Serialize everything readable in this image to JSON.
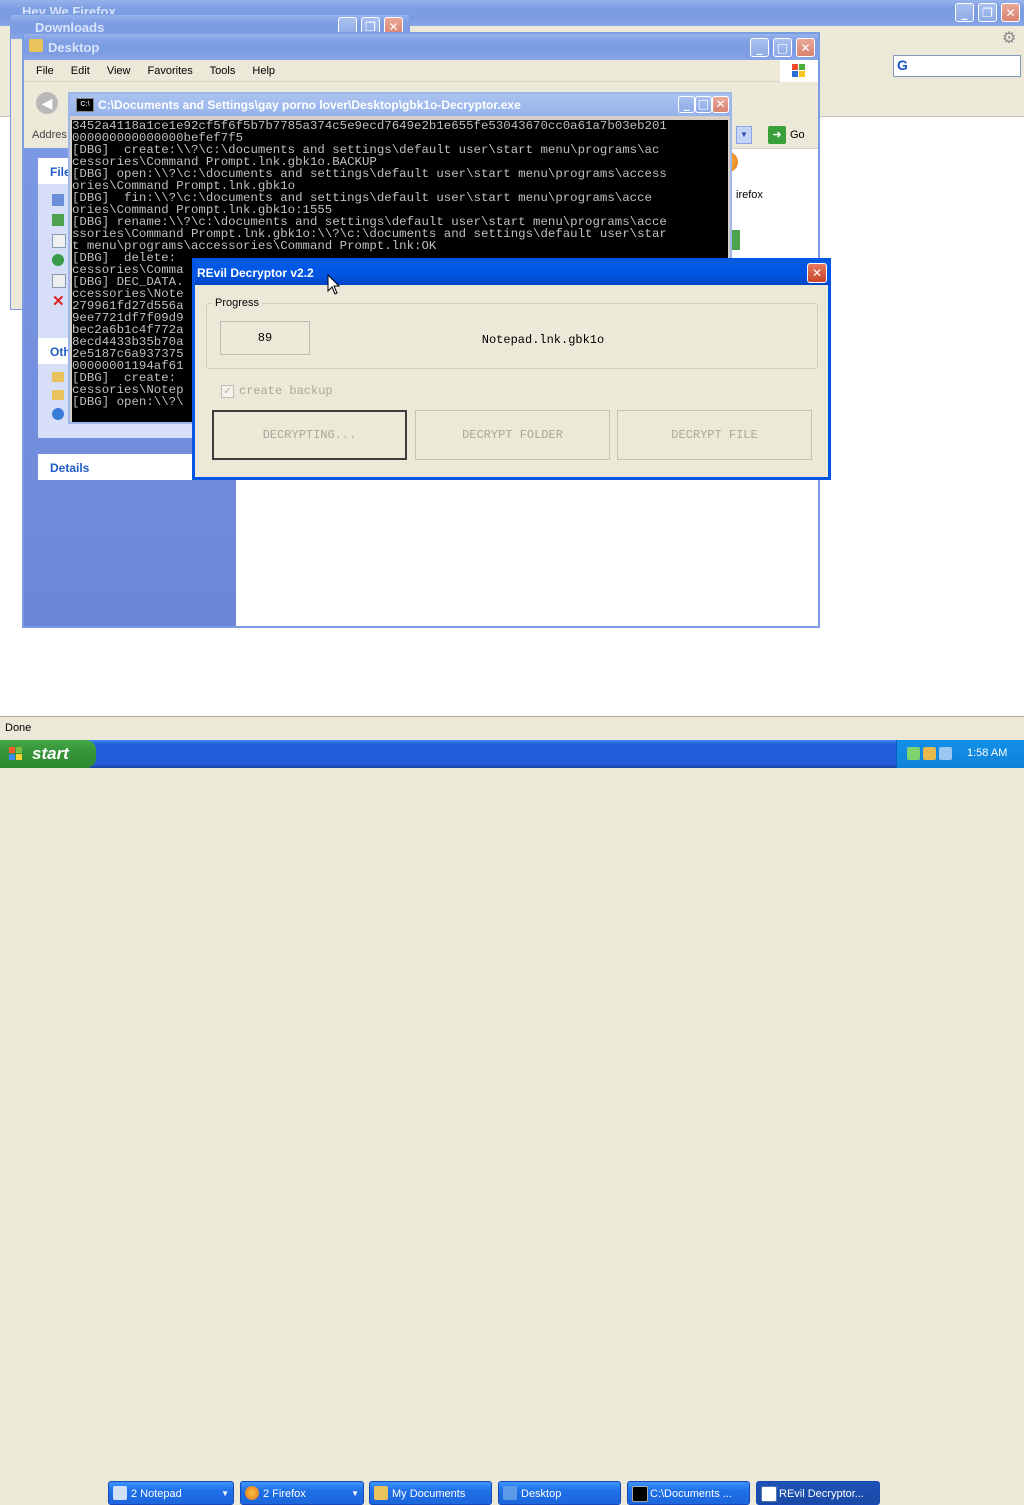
{
  "firefox_back": {
    "title": "Hey We Firefox"
  },
  "downloads_window": {
    "title": "Downloads"
  },
  "desktop_window": {
    "title": "Desktop",
    "menu": [
      "File",
      "Edit",
      "View",
      "Favorites",
      "Tools",
      "Help"
    ],
    "address_label": "Addres",
    "go_label": "Go",
    "file_tasks_label": "File",
    "other_places_label": "Oth",
    "details_label": "Details",
    "firefox_icon_label": "irefox"
  },
  "console_window": {
    "title": "C:\\Documents and Settings\\gay porno lover\\Desktop\\gbk1o-Decryptor.exe",
    "lines": [
      "3452a4118a1ce1e92cf5f6f5b7b7785a374c5e9ecd7649e2b1e655fe53043670cc0a61a7b03eb201",
      "000000000000000befef7f5",
      "[DBG]  create:\\\\?\\c:\\documents and settings\\default user\\start menu\\programs\\ac",
      "cessories\\Command Prompt.lnk.gbk1o.BACKUP",
      "[DBG] open:\\\\?\\c:\\documents and settings\\default user\\start menu\\programs\\access",
      "ories\\Command Prompt.lnk.gbk1o",
      "[DBG]  fin:\\\\?\\c:\\documents and settings\\default user\\start menu\\programs\\acce",
      "ories\\Command Prompt.lnk.gbk1o:1555",
      "[DBG] rename:\\\\?\\c:\\documents and settings\\default user\\start menu\\programs\\acce",
      "ssories\\Command Prompt.lnk.gbk1o:\\\\?\\c:\\documents and settings\\default user\\star",
      "t menu\\programs\\accessories\\Command Prompt.lnk:OK",
      "[DBG]  delete:",
      "cessories\\Comma",
      "[DBG] DEC_DATA.",
      "ccessories\\Note",
      "279961fd27d556a",
      "9ee7721df7f09d9",
      "bec2a6b1c4f772a",
      "8ecd4433b35b70a",
      "2e5187c6a937375",
      "00000001194af61",
      "[DBG]  create:",
      "cessories\\Notep",
      "[DBG] open:\\\\?\\"
    ]
  },
  "dialog": {
    "title": "REvil Decryptor v2.2",
    "group_label": "Progress",
    "progress_value": "89",
    "current_file": "Notepad.lnk.gbk1o",
    "checkbox_label": "create backup",
    "checkbox_checked": true,
    "buttons": {
      "decrypting": "DECRYPTING...",
      "folder": "DECRYPT FOLDER",
      "file": "DECRYPT FILE"
    }
  },
  "status_bar": {
    "text": "Done"
  },
  "taskbar": {
    "start_label": "start",
    "items": [
      {
        "label": "2 Notepad"
      },
      {
        "label": "2 Firefox"
      },
      {
        "label": "My Documents"
      },
      {
        "label": "Desktop"
      },
      {
        "label": "C:\\Documents ..."
      },
      {
        "label": "REvil Decryptor..."
      }
    ],
    "clock": "1:58 AM"
  }
}
